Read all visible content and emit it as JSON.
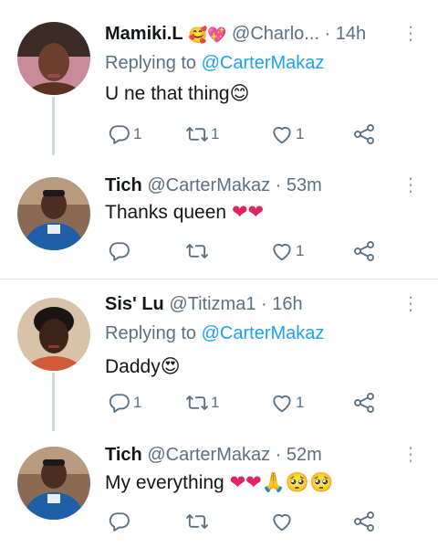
{
  "replying_prefix": "Replying to",
  "tweets": [
    {
      "name": "Mamiki.L",
      "name_emoji": "🥰💖",
      "handle": "@Charlo...",
      "time": "14h",
      "replying_to": "@CarterMakaz",
      "text": "U ne that thing",
      "text_emoji": "😊",
      "reply_count": "1",
      "retweet_count": "1",
      "like_count": "1",
      "avatar_colors": {
        "bg": "#c98a9a",
        "face": "#6b3f2c",
        "top": "#3b2a26"
      }
    },
    {
      "name": "Tich",
      "handle": "@CarterMakaz",
      "time": "53m",
      "text": "Thanks queen",
      "text_emoji": "❤❤",
      "reply_count": "",
      "retweet_count": "",
      "like_count": "1",
      "avatar_colors": {
        "bg": "#8a6a55",
        "face": "#4a2e22",
        "shirt": "#1f5fa8"
      }
    },
    {
      "name": "Sis' Lu",
      "handle": "@Titizma1",
      "time": "16h",
      "replying_to": "@CarterMakaz",
      "text": "Daddy",
      "text_emoji": "😍",
      "reply_count": "1",
      "retweet_count": "1",
      "like_count": "1",
      "avatar_colors": {
        "bg": "#d9c3a8",
        "face": "#3c2419",
        "top": "#1a1412"
      }
    },
    {
      "name": "Tich",
      "handle": "@CarterMakaz",
      "time": "52m",
      "text": "My everything",
      "text_emoji": "❤❤🙏🥺🥺",
      "reply_count": "",
      "retweet_count": "",
      "like_count": "",
      "avatar_colors": {
        "bg": "#8a6a55",
        "face": "#4a2e22",
        "shirt": "#1f5fa8"
      }
    }
  ],
  "colors": {
    "link": "#1da1f2",
    "secondary": "#5b7083",
    "heart": "#e0245e"
  }
}
